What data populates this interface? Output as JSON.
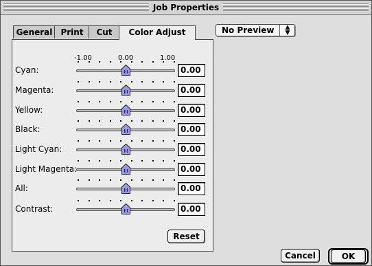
{
  "window": {
    "title": "Job Properties"
  },
  "tabs": [
    {
      "label": "General",
      "active": false
    },
    {
      "label": "Print",
      "active": false
    },
    {
      "label": "Cut",
      "active": false
    },
    {
      "label": "Color Adjust",
      "active": true
    }
  ],
  "preview": {
    "selected": "No Preview"
  },
  "scale": {
    "min": "-1.00",
    "mid": "0.00",
    "max": "1.00"
  },
  "rows": [
    {
      "label": "Cyan:",
      "value": "0.00"
    },
    {
      "label": "Magenta:",
      "value": "0.00"
    },
    {
      "label": "Yellow:",
      "value": "0.00"
    },
    {
      "label": "Black:",
      "value": "0.00"
    },
    {
      "label": "Light Cyan:",
      "value": "0.00"
    },
    {
      "label": "Light Magenta:",
      "value": "0.00"
    },
    {
      "label": "All:",
      "value": "0.00"
    },
    {
      "label": "Contrast:",
      "value": "0.00"
    }
  ],
  "buttons": {
    "reset": "Reset",
    "cancel": "Cancel",
    "ok": "OK"
  },
  "colors": {
    "thumb": "#9a9ae0",
    "window_bg": "#dedede",
    "panel_bg": "#ececec"
  }
}
